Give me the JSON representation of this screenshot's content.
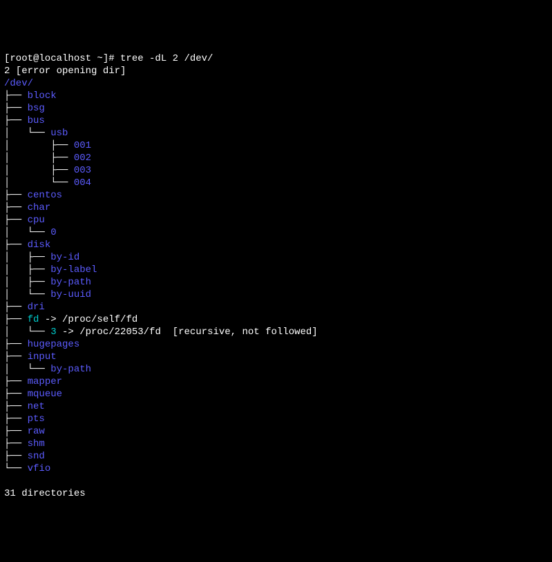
{
  "prompt": "[root@localhost ~]# tree -dL 2 /dev/",
  "error": "2 [error opening dir]",
  "root": "/dev/",
  "lines": [
    {
      "prefix": "├── ",
      "name": "block",
      "cls": "blue"
    },
    {
      "prefix": "├── ",
      "name": "bsg",
      "cls": "blue"
    },
    {
      "prefix": "├── ",
      "name": "bus",
      "cls": "blue"
    },
    {
      "prefix": "│   └── ",
      "name": "usb",
      "cls": "blue"
    },
    {
      "prefix": "│       ├── ",
      "name": "001",
      "cls": "blue"
    },
    {
      "prefix": "│       ├── ",
      "name": "002",
      "cls": "blue"
    },
    {
      "prefix": "│       ├── ",
      "name": "003",
      "cls": "blue"
    },
    {
      "prefix": "│       └── ",
      "name": "004",
      "cls": "blue"
    },
    {
      "prefix": "├── ",
      "name": "centos",
      "cls": "blue"
    },
    {
      "prefix": "├── ",
      "name": "char",
      "cls": "blue"
    },
    {
      "prefix": "├── ",
      "name": "cpu",
      "cls": "blue"
    },
    {
      "prefix": "│   └── ",
      "name": "0",
      "cls": "blue"
    },
    {
      "prefix": "├── ",
      "name": "disk",
      "cls": "blue"
    },
    {
      "prefix": "│   ├── ",
      "name": "by-id",
      "cls": "blue"
    },
    {
      "prefix": "│   ├── ",
      "name": "by-label",
      "cls": "blue"
    },
    {
      "prefix": "│   ├── ",
      "name": "by-path",
      "cls": "blue"
    },
    {
      "prefix": "│   └── ",
      "name": "by-uuid",
      "cls": "blue"
    },
    {
      "prefix": "├── ",
      "name": "dri",
      "cls": "blue"
    },
    {
      "prefix": "├── ",
      "name": "fd",
      "cls": "cyan",
      "target": " -> /proc/self/fd"
    },
    {
      "prefix": "│   └── ",
      "name": "3",
      "cls": "cyan",
      "target": " -> /proc/22053/fd",
      "note": "  [recursive, not followed]"
    },
    {
      "prefix": "├── ",
      "name": "hugepages",
      "cls": "blue"
    },
    {
      "prefix": "├── ",
      "name": "input",
      "cls": "blue"
    },
    {
      "prefix": "│   └── ",
      "name": "by-path",
      "cls": "blue"
    },
    {
      "prefix": "├── ",
      "name": "mapper",
      "cls": "blue"
    },
    {
      "prefix": "├── ",
      "name": "mqueue",
      "cls": "blue"
    },
    {
      "prefix": "├── ",
      "name": "net",
      "cls": "blue"
    },
    {
      "prefix": "├── ",
      "name": "pts",
      "cls": "blue"
    },
    {
      "prefix": "├── ",
      "name": "raw",
      "cls": "blue"
    },
    {
      "prefix": "├── ",
      "name": "shm",
      "cls": "blue"
    },
    {
      "prefix": "├── ",
      "name": "snd",
      "cls": "blue"
    },
    {
      "prefix": "└── ",
      "name": "vfio",
      "cls": "blue"
    }
  ],
  "blank": "",
  "summary": "31 directories"
}
